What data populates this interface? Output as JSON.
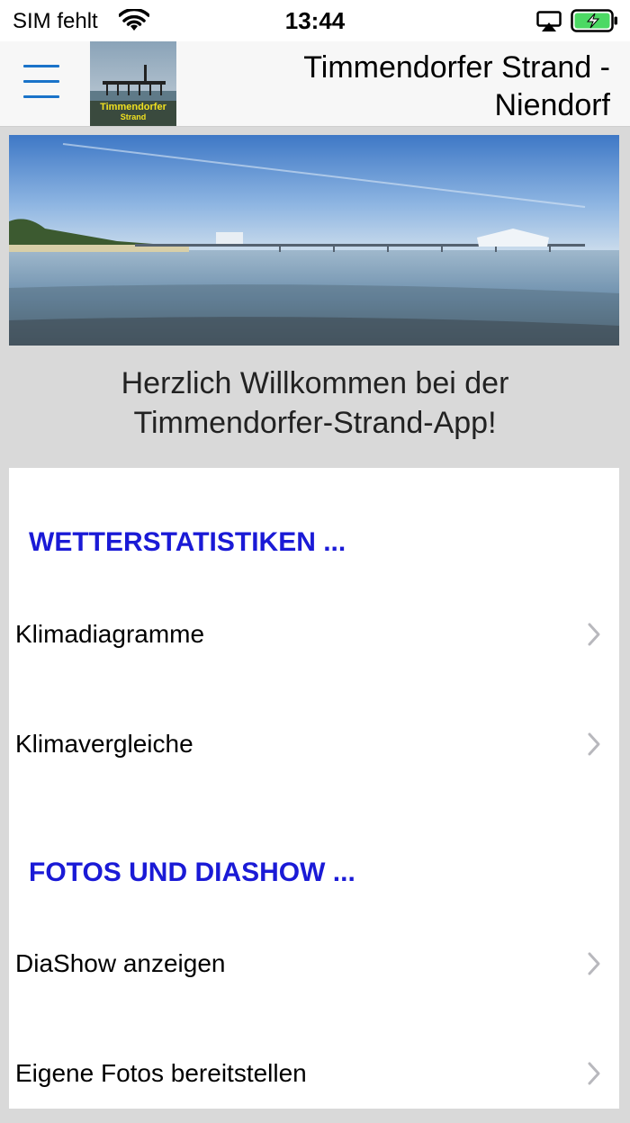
{
  "status_bar": {
    "carrier": "SIM fehlt",
    "time": "13:44",
    "battery_color": "#4cd964"
  },
  "nav": {
    "title": "Timmendorfer Strand - Niendorf",
    "logo_text_line1": "Timmendorfer",
    "logo_text_line2": "Strand",
    "accent": "#1a73c9"
  },
  "welcome": {
    "line1": "Herzlich Willkommen bei der",
    "line2": "Timmendorfer-Strand-App!"
  },
  "sections": [
    {
      "header": "WETTERSTATISTIKEN ...",
      "items": [
        {
          "label": "Klimadiagramme"
        },
        {
          "label": "Klimavergleiche"
        }
      ]
    },
    {
      "header": "FOTOS UND DIASHOW ...",
      "items": [
        {
          "label": "DiaShow anzeigen"
        },
        {
          "label": "Eigene Fotos bereitstellen"
        }
      ]
    }
  ],
  "section_header_color": "#1a1ad6"
}
